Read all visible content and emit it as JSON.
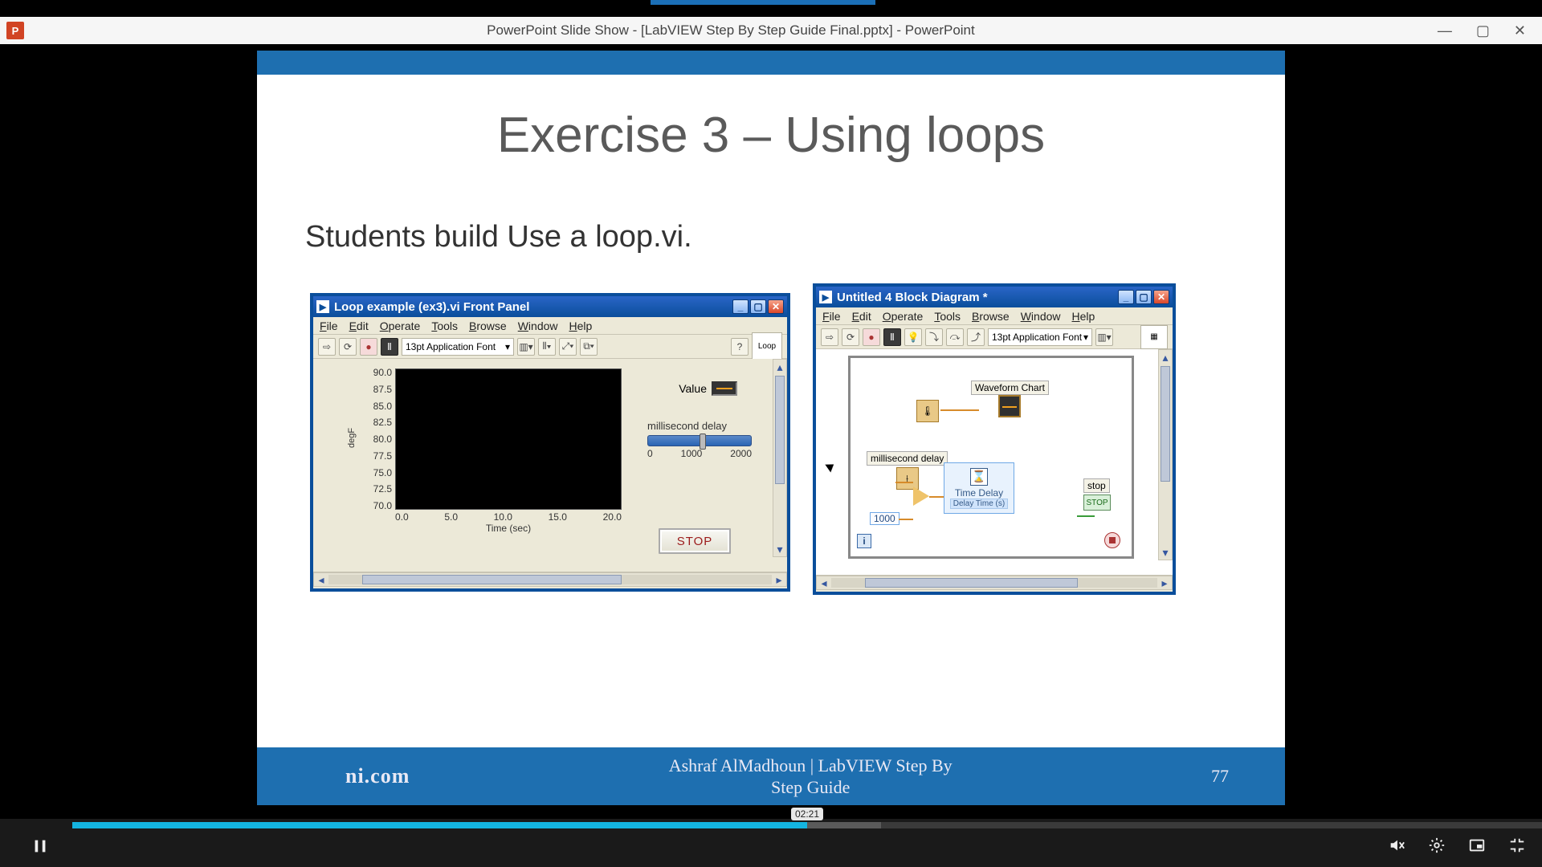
{
  "powerpoint": {
    "app_icon_text": "P",
    "title": "PowerPoint Slide Show - [LabVIEW Step By Step Guide Final.pptx] - PowerPoint"
  },
  "slide": {
    "title": "Exercise 3 – Using loops",
    "subtitle": "Students build Use a loop.vi.",
    "footer_brand": "ni.com",
    "footer_center": "Ashraf AlMadhoun | LabVIEW Step By\nStep Guide",
    "page_number": "77"
  },
  "front_panel": {
    "title": "Loop example (ex3).vi Front Panel",
    "menus": [
      "File",
      "Edit",
      "Operate",
      "Tools",
      "Browse",
      "Window",
      "Help"
    ],
    "font_box": "13pt Application Font",
    "icon_slot": "Loop",
    "legend_label": "Value",
    "chart": {
      "y_ticks": [
        "90.0",
        "87.5",
        "85.0",
        "82.5",
        "80.0",
        "77.5",
        "75.0",
        "72.5",
        "70.0"
      ],
      "y_axis_label": "degF",
      "x_ticks": [
        "0.0",
        "5.0",
        "10.0",
        "15.0",
        "20.0"
      ],
      "x_axis_label": "Time (sec)"
    },
    "slider": {
      "label": "millisecond delay",
      "scale": [
        "0",
        "1000",
        "2000"
      ]
    },
    "stop_label": "STOP"
  },
  "block_diagram": {
    "title": "Untitled 4 Block Diagram *",
    "menus": [
      "File",
      "Edit",
      "Operate",
      "Tools",
      "Browse",
      "Window",
      "Help"
    ],
    "font_box": "13pt Application Font",
    "nodes": {
      "waveform_chart": "Waveform Chart",
      "ms_delay": "millisecond delay",
      "time_delay": "Time Delay",
      "time_delay_sub": "Delay Time (s)",
      "stop_lbl": "stop",
      "stop_btn": "STOP",
      "iter_constant": "1000",
      "loop_i": "i"
    }
  },
  "player": {
    "tooltip_time": "02:21"
  }
}
